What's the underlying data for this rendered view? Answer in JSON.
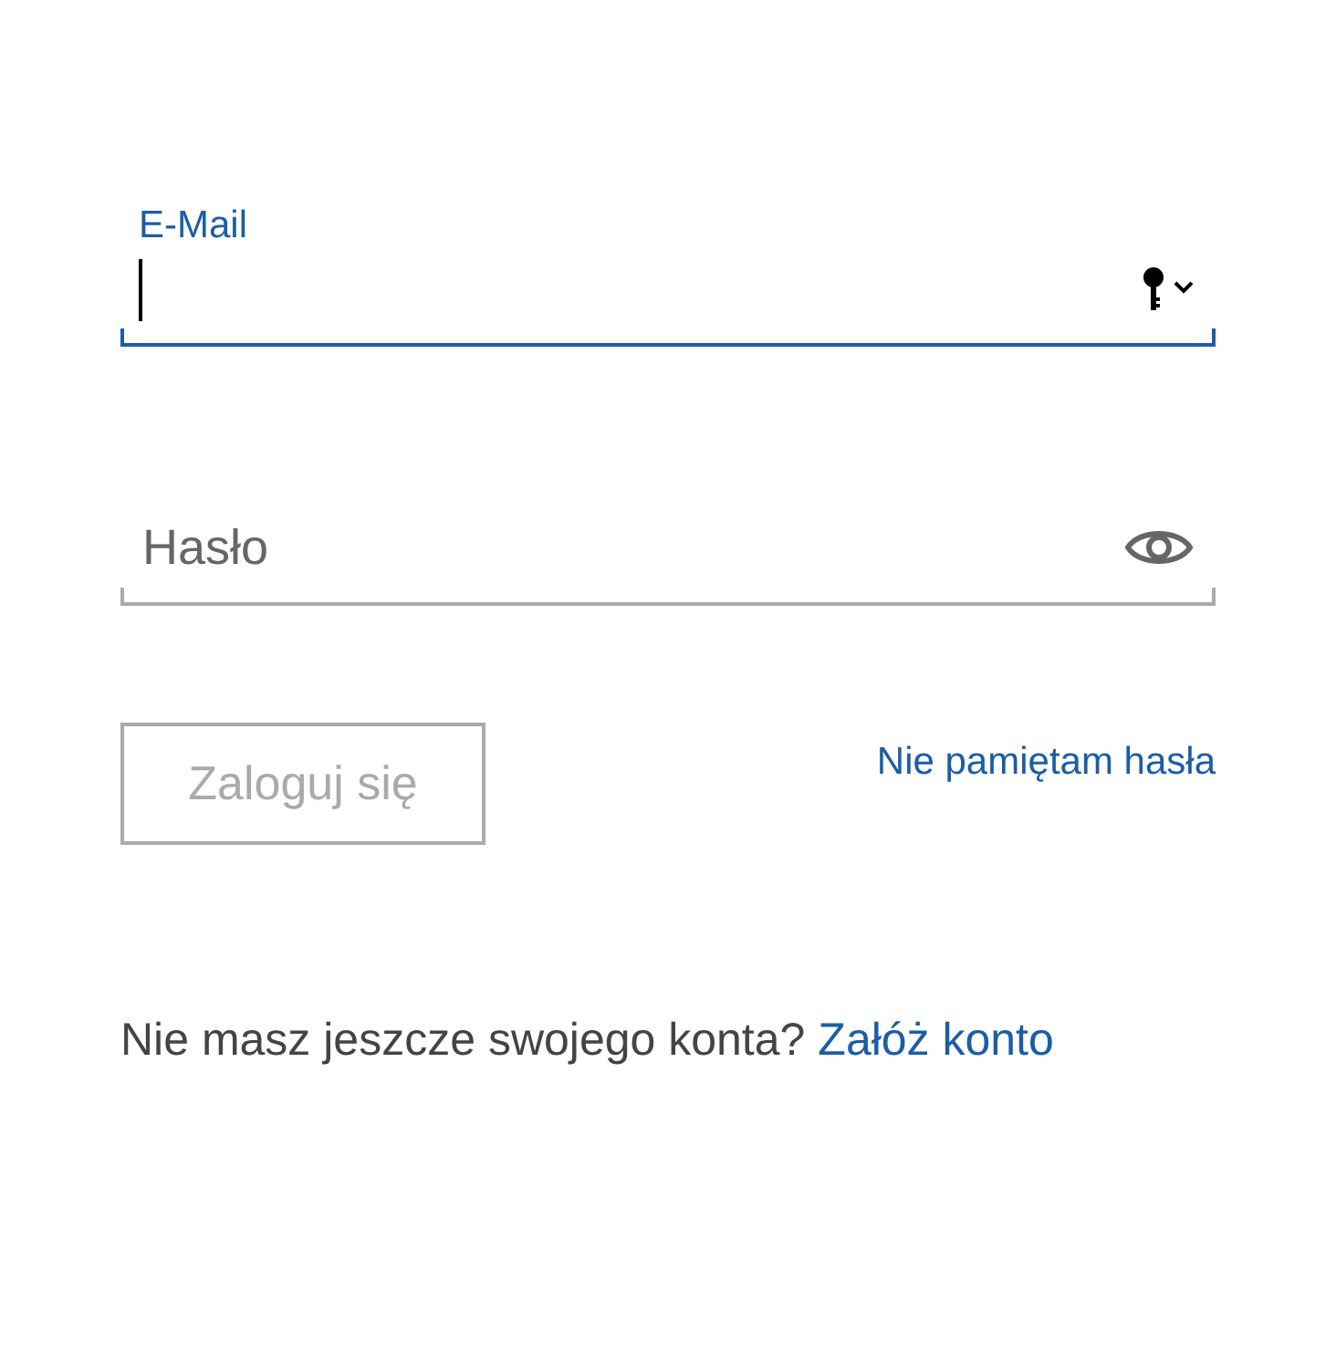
{
  "fields": [
    {
      "kind": "email",
      "label": "E-Mail",
      "focused": true
    },
    {
      "kind": "password",
      "placeholder": "Hasło",
      "focused": false
    }
  ],
  "login_button": {
    "label": "Zaloguj się",
    "disabled": true
  },
  "forgot_link": "Nie pamiętam hasła",
  "signup": {
    "text": "Nie masz jeszcze swojego konta?",
    "link": "Załóż konto"
  }
}
